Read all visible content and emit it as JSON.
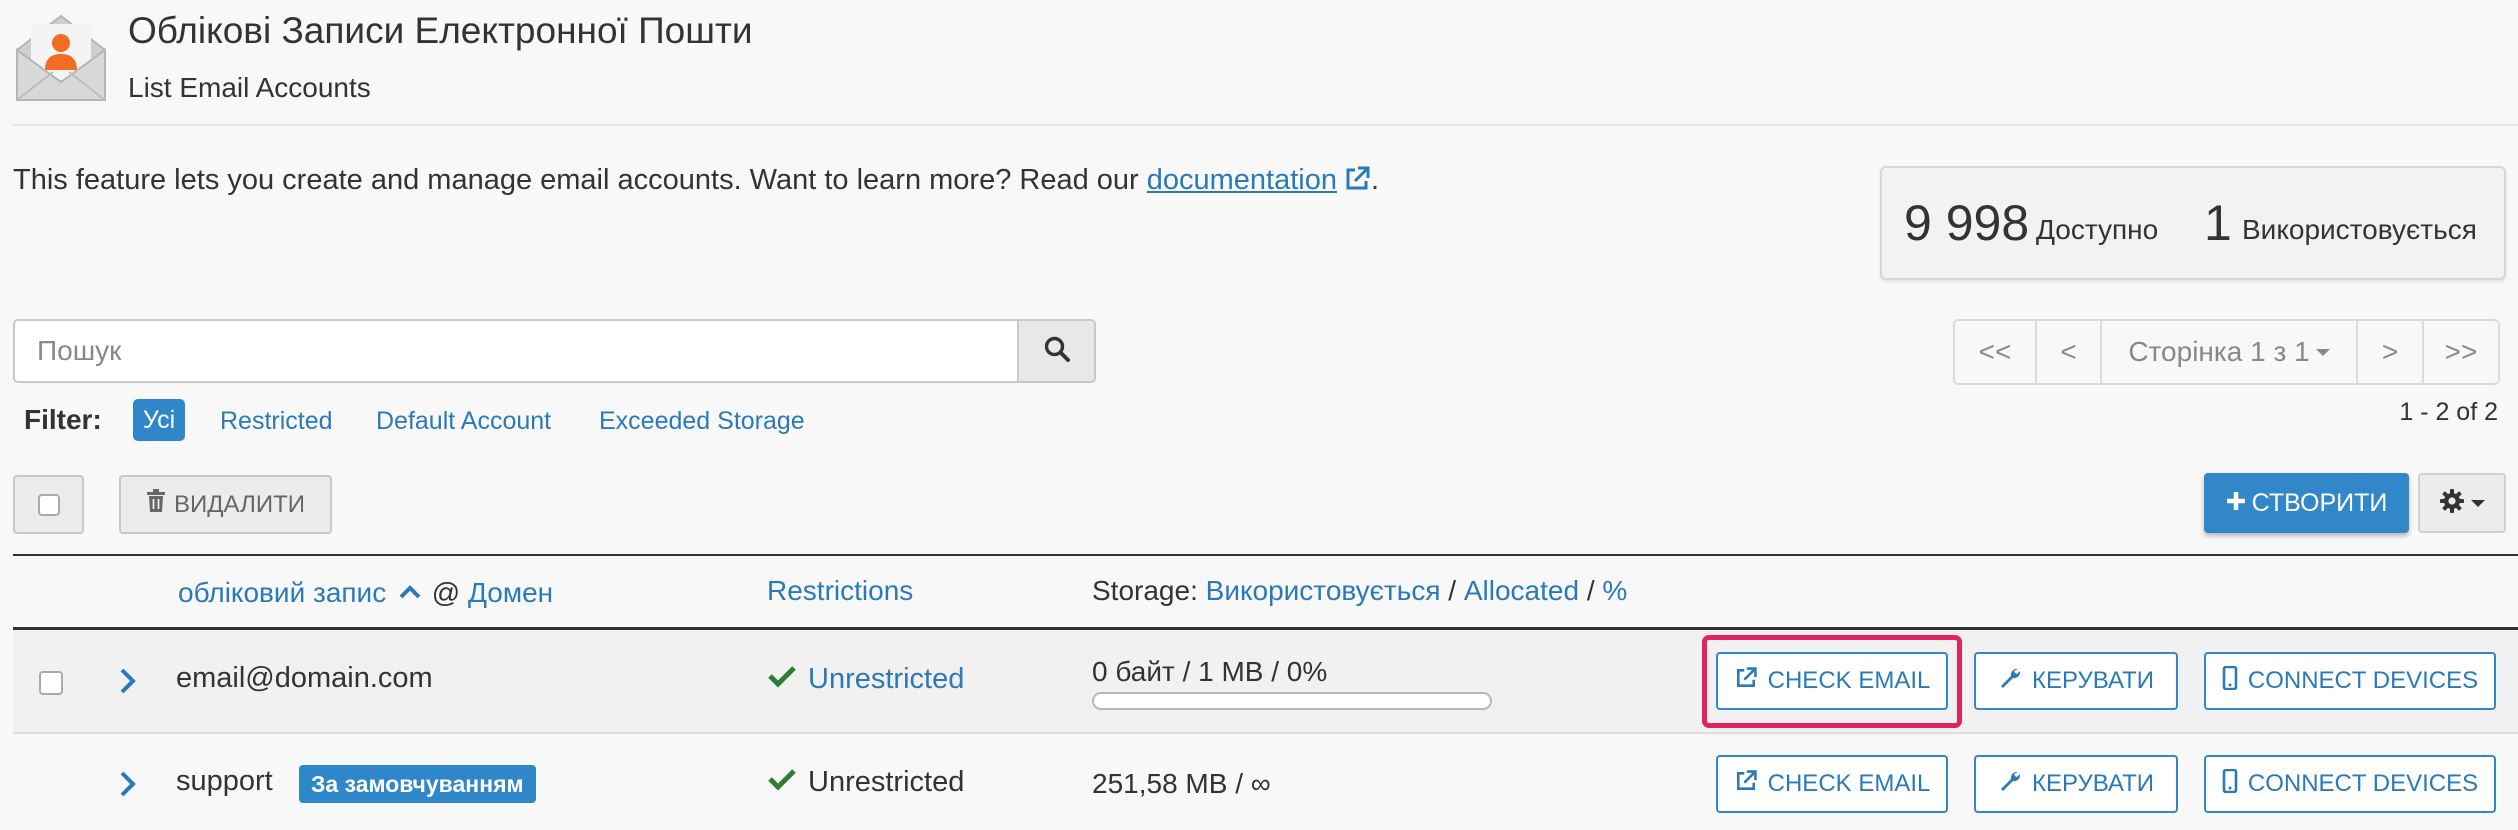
{
  "header": {
    "title": "Облікові Записи Електронної Пошти",
    "subtitle": "List Email Accounts"
  },
  "intro": {
    "text": "This feature lets you create and manage email accounts. Want to learn more? Read our ",
    "link_text": "documentation",
    "trailing": "."
  },
  "stats": {
    "available_count": "9 998",
    "available_label": "Доступно",
    "used_count": "1",
    "used_label": "Використовується"
  },
  "search": {
    "placeholder": "Пошук",
    "value": ""
  },
  "pagination": {
    "first": "<<",
    "prev": "<",
    "page_label": "Сторінка 1 з 1",
    "next": ">",
    "last": ">>",
    "range": "1 - 2 of 2"
  },
  "filter": {
    "label": "Filter:",
    "options": [
      "Усі",
      "Restricted",
      "Default Account",
      "Exceeded Storage"
    ],
    "active": "Усі"
  },
  "toolbar": {
    "delete_label": "ВИДАЛИТИ",
    "create_label": "СТВОРИТИ"
  },
  "table": {
    "headers": {
      "account": "обліковий запис",
      "at": "@",
      "domain": "Домен",
      "restrictions": "Restrictions",
      "storage_prefix": "Storage:",
      "storage_used": "Використовується",
      "sep1": "/",
      "storage_allocated": "Allocated",
      "sep2": "/",
      "storage_percent": "%"
    },
    "rows": [
      {
        "email": "email@domain.com",
        "badge": "",
        "restriction": "Unrestricted",
        "storage": "0 байт / 1 MB / 0%",
        "usage_fraction": 0,
        "check_email": "CHECK EMAIL",
        "manage": "КЕРУВАТИ",
        "connect": "CONNECT DEVICES"
      },
      {
        "email": "support",
        "badge": "За замовчуванням",
        "restriction": "Unrestricted",
        "storage": "251,58 MB / ∞",
        "check_email": "CHECK EMAIL",
        "manage": "КЕРУВАТИ",
        "connect": "CONNECT DEVICES"
      }
    ]
  },
  "colors": {
    "accent": "#3287c9",
    "link": "#2b7ab8",
    "success": "#2e7d32",
    "highlight": "#e0245e"
  },
  "icons": [
    "email-account-icon",
    "external-link-icon",
    "search-icon",
    "trash-icon",
    "plus-icon",
    "gear-icon",
    "chevron-right-icon",
    "check-icon",
    "wrench-icon",
    "mobile-icon",
    "sort-up-icon"
  ]
}
